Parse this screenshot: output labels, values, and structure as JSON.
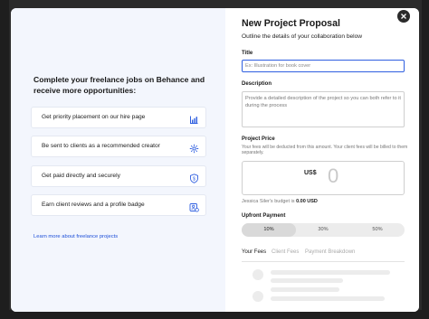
{
  "promo": {
    "headline": "Complete your freelance jobs on Behance and receive more opportunities:",
    "benefits": [
      {
        "label": "Get priority placement on our hire page",
        "icon": "ranking-chart-icon"
      },
      {
        "label": "Be sent to clients as a recommended creator",
        "icon": "sparkle-icon"
      },
      {
        "label": "Get paid directly and securely",
        "icon": "shield-dollar-icon"
      },
      {
        "label": "Earn client reviews and a profile badge",
        "icon": "profile-badge-icon"
      }
    ],
    "learn_more": "Learn more about freelance projects"
  },
  "form": {
    "title": "New Project Proposal",
    "subtitle": "Outline the details of your collaboration below",
    "title_label": "Title",
    "title_placeholder": "Ex: Illustration for book cover",
    "description_label": "Description",
    "description_placeholder": "Provide a detailed description of the project so you can both refer to it during the process",
    "price_label": "Project Price",
    "price_note": "Your fees will be deducted from this amount. Your client fees will be billed to them separately.",
    "currency": "US$",
    "amount": "0",
    "budget_prefix": "Jessica Siler's budget is",
    "budget_value": "0.00 USD",
    "upfront_label": "Upfront Payment",
    "upfront_options": [
      "10%",
      "30%",
      "50%"
    ],
    "upfront_selected": "10%",
    "tabs": [
      "Your Fees",
      "Client Fees",
      "Payment Breakdown"
    ],
    "active_tab": "Your Fees"
  },
  "colors": {
    "accent": "#2f5fe0",
    "link": "#1d4fd8",
    "left_panel_bg": "#f3f6fd",
    "backdrop": "#2b2b2b"
  }
}
